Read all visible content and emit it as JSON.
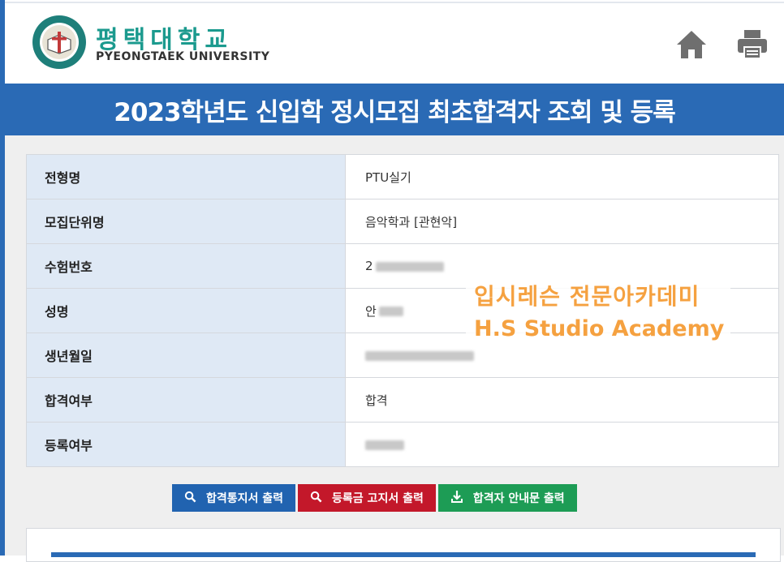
{
  "header": {
    "logo_korean": "평택대학교",
    "logo_english": "PYEONGTAEK UNIVERSITY",
    "home_icon": "home-icon",
    "print_icon": "printer-icon"
  },
  "title": "2023학년도 신입학 정시모집 최초합격자 조회 및 등록",
  "info_rows": [
    {
      "label": "전형명",
      "value": "PTU실기"
    },
    {
      "label": "모집단위명",
      "value": "음악학과 [관현악]"
    },
    {
      "label": "수험번호",
      "value": "2"
    },
    {
      "label": "성명",
      "value": "안"
    },
    {
      "label": "생년월일",
      "value": ""
    },
    {
      "label": "합격여부",
      "value": "합격"
    },
    {
      "label": "등록여부",
      "value": ""
    }
  ],
  "buttons": {
    "notice": "합격통지서 출력",
    "invoice": "등록금 고지서 출력",
    "guide": "합격자 안내문 출력"
  },
  "watermark": {
    "line1": "입시레슨 전문아카데미",
    "line2": "H.S Studio Academy"
  },
  "colors": {
    "primary": "#2a6ab5",
    "label_bg": "#dfe9f5",
    "btn_blue": "#2163b0",
    "btn_red": "#c3182a",
    "btn_green": "#1d9c55",
    "watermark": "#f5a140",
    "logo": "#1b9a8e"
  }
}
